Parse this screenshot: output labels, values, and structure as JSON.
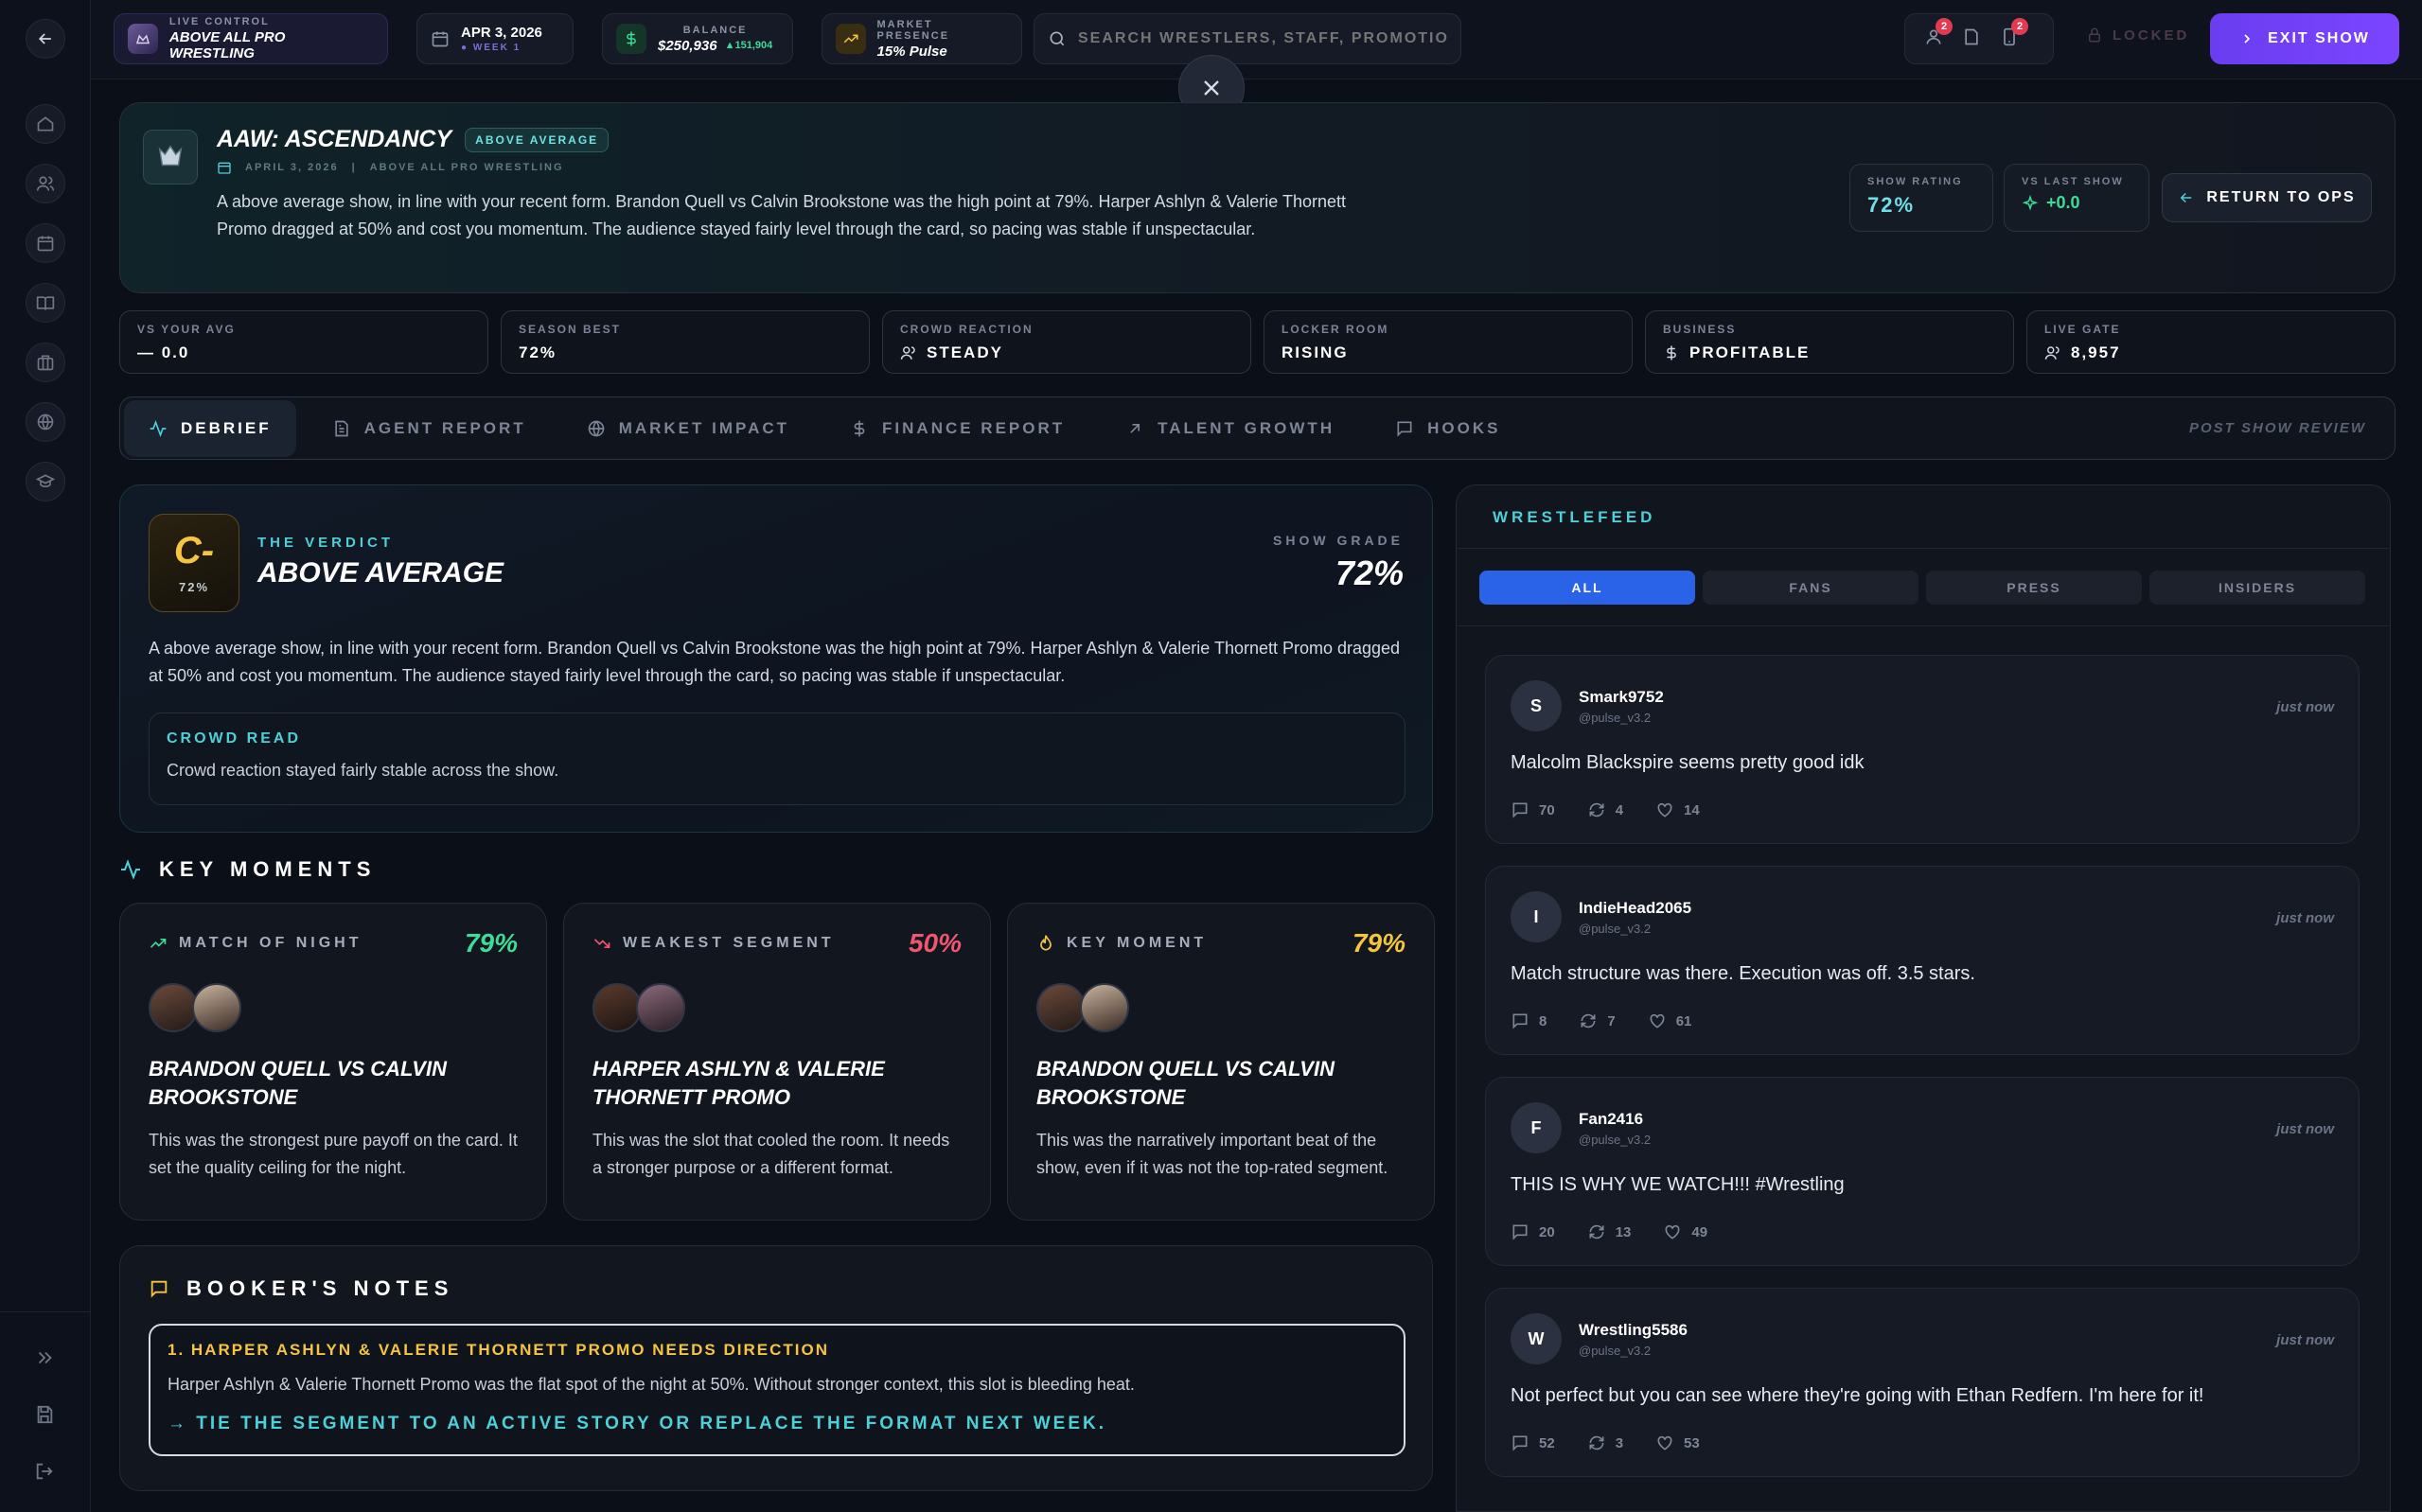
{
  "topbar": {
    "live_control_label": "LIVE CONTROL",
    "promotion": "ABOVE ALL PRO WRESTLING",
    "date": "APR 3, 2026",
    "week": "● WEEK 1",
    "balance_label": "BALANCE",
    "balance": "$250,936",
    "balance_delta": "▲151,904",
    "market_label": "MARKET PRESENCE",
    "market_value": "15% Pulse",
    "search_placeholder": "SEARCH WRESTLERS, STAFF, PROMOTIONS...",
    "badge_users": "2",
    "badge_phone": "2",
    "locked_label": "LOCKED",
    "exit_label": "EXIT SHOW"
  },
  "show": {
    "title": "AAW: ASCENDANCY",
    "rating_badge": "ABOVE AVERAGE",
    "date": "APRIL 3, 2026",
    "separator": "|",
    "promotion": "ABOVE ALL PRO WRESTLING",
    "summary": "A above average show, in line with your recent form. Brandon Quell vs Calvin Brookstone was the high point at 79%. Harper Ashlyn & Valerie Thornett Promo dragged at 50% and cost you momentum. The audience stayed fairly level through the card, so pacing was stable if unspectacular.",
    "show_rating_label": "SHOW RATING",
    "show_rating": "72%",
    "vs_last_label": "VS LAST SHOW",
    "vs_last": "+0.0",
    "return_label": "RETURN TO OPS"
  },
  "stats": [
    {
      "label": "VS YOUR AVG",
      "value": "— 0.0"
    },
    {
      "label": "SEASON BEST",
      "value": "72%"
    },
    {
      "label": "CROWD REACTION",
      "value": "STEADY"
    },
    {
      "label": "LOCKER ROOM",
      "value": "RISING"
    },
    {
      "label": "BUSINESS",
      "value": "PROFITABLE"
    },
    {
      "label": "LIVE GATE",
      "value": "8,957"
    }
  ],
  "tabs": [
    "DEBRIEF",
    "AGENT REPORT",
    "MARKET IMPACT",
    "FINANCE REPORT",
    "TALENT GROWTH",
    "HOOKS"
  ],
  "post_show_label": "POST SHOW REVIEW",
  "verdict": {
    "grade": "C-",
    "grade_pct": "72%",
    "label": "THE VERDICT",
    "title": "ABOVE AVERAGE",
    "show_grade_label": "SHOW GRADE",
    "show_grade": "72%",
    "text": "A above average show, in line with your recent form. Brandon Quell vs Calvin Brookstone was the high point at 79%. Harper Ashlyn & Valerie Thornett Promo dragged at 50% and cost you momentum. The audience stayed fairly level through the card, so pacing was stable if unspectacular.",
    "crowd_label": "CROWD READ",
    "crowd_text": "Crowd reaction stayed fairly stable across the show."
  },
  "key_moments_title": "KEY MOMENTS",
  "moments": [
    {
      "label": "MATCH OF NIGHT",
      "pct": "79%",
      "title": "BRANDON QUELL VS CALVIN BROOKSTONE",
      "text": "This was the strongest pure payoff on the card. It set the quality ceiling for the night.",
      "color": "#3ddc97"
    },
    {
      "label": "WEAKEST SEGMENT",
      "pct": "50%",
      "title": "HARPER ASHLYN & VALERIE THORNETT PROMO",
      "text": "This was the slot that cooled the room. It needs a stronger purpose or a different format.",
      "color": "#f0566f"
    },
    {
      "label": "KEY MOMENT",
      "pct": "79%",
      "title": "BRANDON QUELL VS CALVIN BROOKSTONE",
      "text": "This was the narratively important beat of the show, even if it was not the top-rated segment.",
      "color": "#f5c542"
    }
  ],
  "notes": {
    "title": "BOOKER'S NOTES",
    "item_title": "1. HARPER ASHLYN & VALERIE THORNETT PROMO NEEDS DIRECTION",
    "item_text": "Harper Ashlyn & Valerie Thornett Promo was the flat spot of the night at 50%. Without stronger context, this slot is bleeding heat.",
    "item_action": "→ TIE THE SEGMENT TO AN ACTIVE STORY OR REPLACE THE FORMAT NEXT WEEK."
  },
  "feed": {
    "title": "WRESTLEFEED",
    "filters": [
      "ALL",
      "FANS",
      "PRESS",
      "INSIDERS"
    ],
    "posts": [
      {
        "initial": "S",
        "name": "Smark9752",
        "handle": "@pulse_v3.2",
        "time": "just now",
        "text": "Malcolm Blackspire seems pretty good idk",
        "replies": "70",
        "reposts": "4",
        "likes": "14"
      },
      {
        "initial": "I",
        "name": "IndieHead2065",
        "handle": "@pulse_v3.2",
        "time": "just now",
        "text": "Match structure was there. Execution was off. 3.5 stars.",
        "replies": "8",
        "reposts": "7",
        "likes": "61"
      },
      {
        "initial": "F",
        "name": "Fan2416",
        "handle": "@pulse_v3.2",
        "time": "just now",
        "text": "THIS IS WHY WE WATCH!!! #Wrestling",
        "replies": "20",
        "reposts": "13",
        "likes": "49"
      },
      {
        "initial": "W",
        "name": "Wrestling5586",
        "handle": "@pulse_v3.2",
        "time": "just now",
        "text": "Not perfect but you can see where they're going with Ethan Redfern. I'm here for it!",
        "replies": "52",
        "reposts": "3",
        "likes": "53"
      }
    ]
  }
}
